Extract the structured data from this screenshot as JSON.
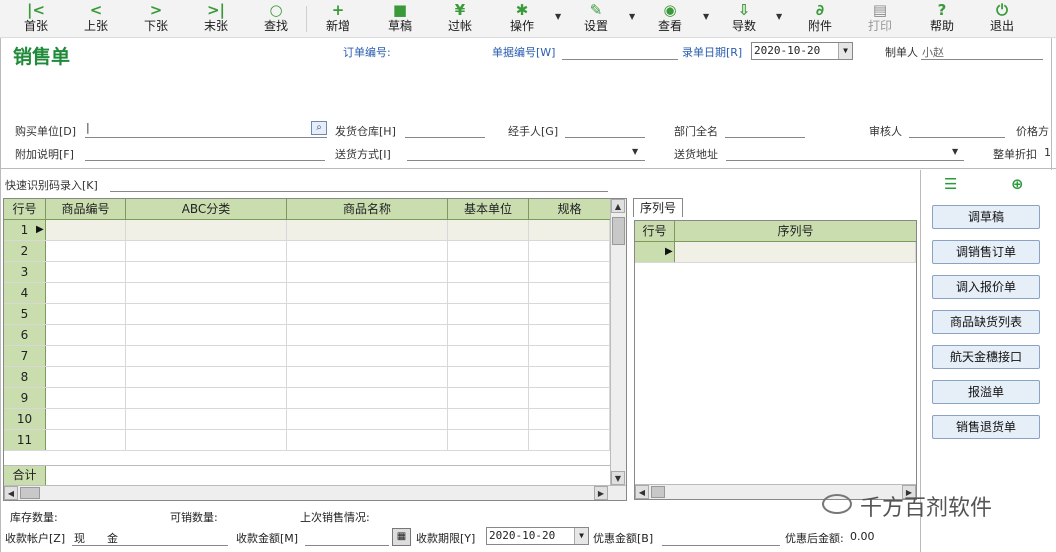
{
  "toolbar": {
    "items": [
      {
        "label": "首张",
        "icon": "first-icon"
      },
      {
        "label": "上张",
        "icon": "prev-icon"
      },
      {
        "label": "下张",
        "icon": "next-icon"
      },
      {
        "label": "末张",
        "icon": "last-icon"
      },
      {
        "label": "查找",
        "icon": "search-icon"
      },
      {
        "label": "新增",
        "icon": "new-icon"
      },
      {
        "label": "草稿",
        "icon": "save-icon"
      },
      {
        "label": "过帐",
        "icon": "post-icon"
      },
      {
        "label": "操作",
        "icon": "gear-icon"
      },
      {
        "label": "设置",
        "icon": "wrench-icon"
      },
      {
        "label": "查看",
        "icon": "eye-icon"
      },
      {
        "label": "导数",
        "icon": "download-icon"
      },
      {
        "label": "附件",
        "icon": "paperclip-icon"
      },
      {
        "label": "打印",
        "icon": "print-icon"
      },
      {
        "label": "帮助",
        "icon": "help-icon"
      },
      {
        "label": "退出",
        "icon": "power-icon"
      }
    ]
  },
  "form": {
    "title": "销售单",
    "order_no_label": "订单编号:",
    "doc_no_label": "单据编号[W]",
    "entry_date_label": "录单日期[R]",
    "entry_date_value": "2020-10-20",
    "creator_label": "制单人",
    "creator_value": "小赵",
    "buyer_label": "购买单位[D]",
    "warehouse_label": "发货仓库[H]",
    "handler_label": "经手人[G]",
    "dept_label": "部门全名",
    "auditor_label": "审核人",
    "price_label": "价格方",
    "extra_note_label": "附加说明[F]",
    "ship_method_label": "送货方式[I]",
    "ship_addr_label": "送货地址",
    "discount_label": "整单折扣",
    "discount_value": "1",
    "quick_code_label": "快速识别码录入[K]"
  },
  "grid": {
    "columns": [
      "行号",
      "商品编号",
      "ABC分类",
      "商品名称",
      "基本单位",
      "规格"
    ],
    "rows": [
      "1",
      "2",
      "3",
      "4",
      "5",
      "6",
      "7",
      "8",
      "9",
      "10",
      "11"
    ],
    "total_label": "合计"
  },
  "serial": {
    "tab_label": "序列号",
    "columns": [
      "行号",
      "序列号"
    ]
  },
  "right_panel": {
    "buttons": [
      "调草稿",
      "调销售订单",
      "调入报价单",
      "商品缺货列表",
      "航天金穗接口",
      "报溢单",
      "销售退货单"
    ]
  },
  "footer": {
    "stock_qty_label": "库存数量:",
    "available_qty_label": "可销数量:",
    "last_sale_label": "上次销售情况:",
    "account_label": "收款帐户[Z]",
    "account_value": "现　　金",
    "amount_label": "收款金额[M]",
    "deadline_label": "收款期限[Y]",
    "deadline_value": "2020-10-20",
    "discount_amount_label": "优惠金额[B]",
    "after_discount_label": "优惠后金额:",
    "after_discount_value": "0.00",
    "watermark": "千方百剂软件"
  },
  "colors": {
    "accent": "#1f8a3a",
    "grid_header": "#c9ddaf",
    "blue_label": "#2a5db0"
  }
}
